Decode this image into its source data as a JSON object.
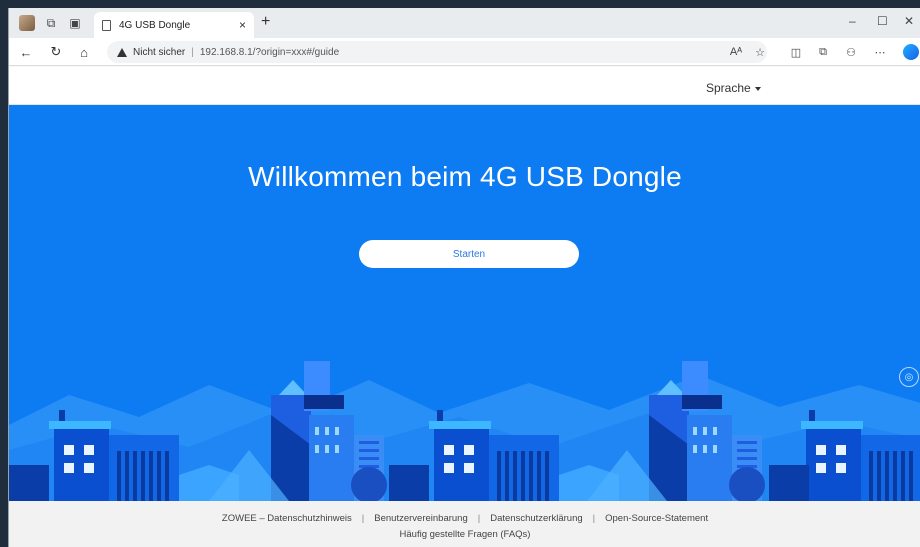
{
  "browser": {
    "tab_title": "4G USB Dongle",
    "tab_close": "×",
    "new_tab": "+",
    "security_label": "Nicht sicher",
    "url": "192.168.8.1/?origin=xxx#/guide",
    "window_minimize": "–",
    "window_maximize": "☐",
    "window_close": "✕"
  },
  "header": {
    "language": "Sprache"
  },
  "hero": {
    "title": "Willkommen beim 4G USB Dongle",
    "start_button": "Starten"
  },
  "footer": {
    "links": [
      "ZOWEE – Datenschutzhinweis",
      "Benutzervereinbarung",
      "Datenschutzerklärung",
      "Open-Source-Statement"
    ],
    "faq": "Häufig gestellte Fragen (FAQs)"
  },
  "colors": {
    "hero_blue": "#0d7cf2",
    "button_text": "#2b79e6",
    "footer_bg": "#f2f2f2"
  },
  "icons": [
    "profile-avatar",
    "workspaces-icon",
    "tab-actions-icon",
    "document-icon",
    "back-icon",
    "refresh-icon",
    "home-icon",
    "warning-icon",
    "read-aloud-icon",
    "favorite-icon",
    "split-screen-icon",
    "collections-icon",
    "extensions-icon",
    "more-icon",
    "copilot-icon",
    "screenshot-icon"
  ]
}
